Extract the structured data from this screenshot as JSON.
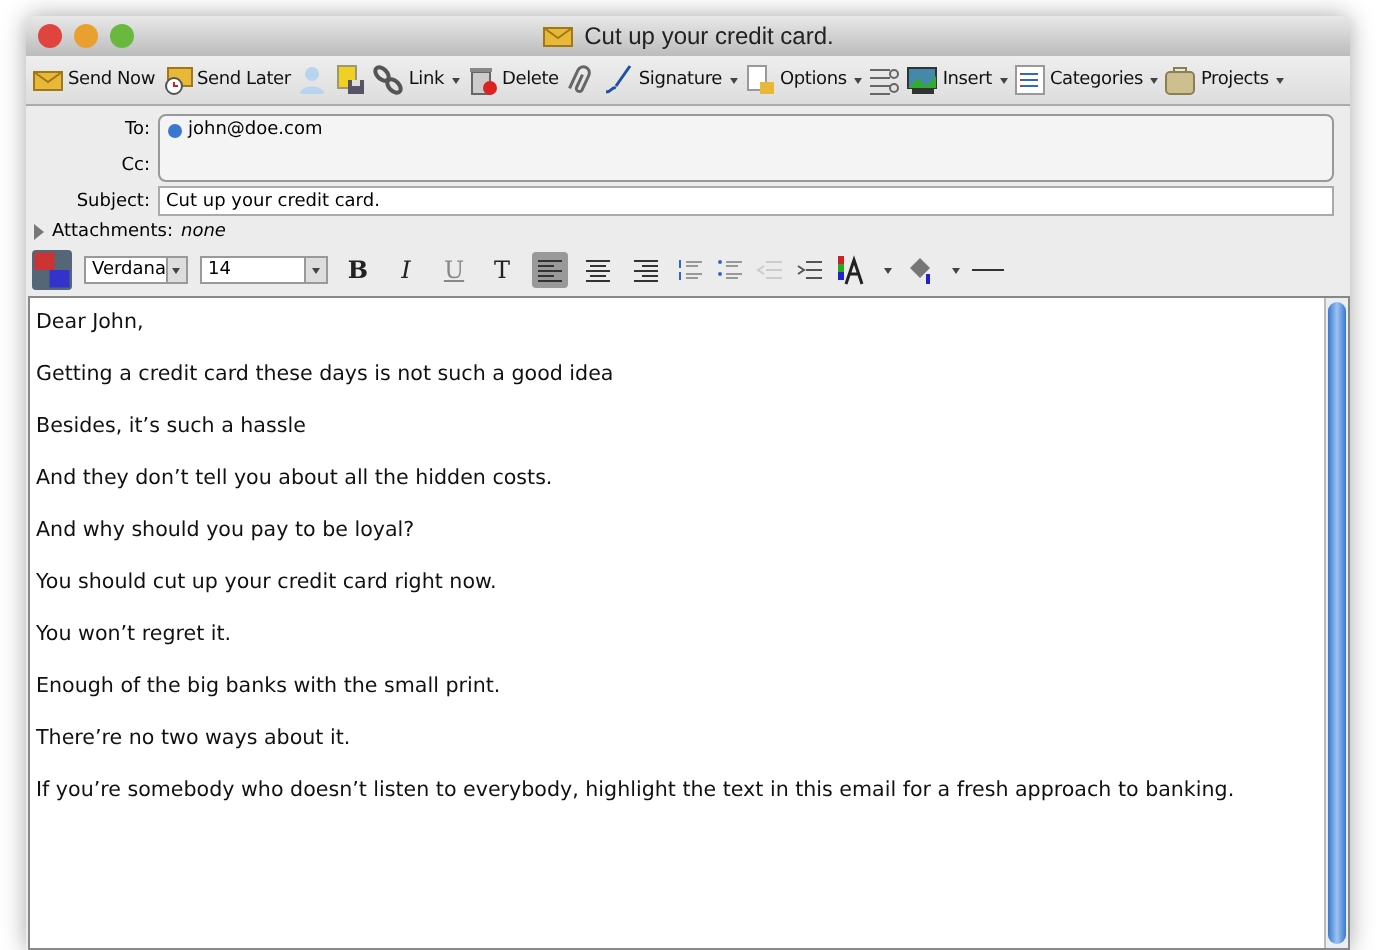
{
  "window": {
    "title": "Cut up your credit card."
  },
  "toolbar": [
    {
      "kind": "button",
      "label": "Send Now"
    },
    {
      "kind": "button",
      "label": "Send Later"
    },
    {
      "kind": "icon"
    },
    {
      "kind": "icon"
    },
    {
      "kind": "menu",
      "label": "Link"
    },
    {
      "kind": "button",
      "label": "Delete"
    },
    {
      "kind": "icon"
    },
    {
      "kind": "menu",
      "label": "Signature"
    },
    {
      "kind": "menu",
      "label": "Options"
    },
    {
      "kind": "icon"
    },
    {
      "kind": "menu",
      "label": "Insert"
    },
    {
      "kind": "menu",
      "label": "Categories"
    },
    {
      "kind": "menu",
      "label": "Projects"
    }
  ],
  "header": {
    "to_label": "To:",
    "to": "john@doe.com",
    "cc_label": "Cc:",
    "subject_label": "Subject:",
    "subject": "Cut up your credit card.",
    "attachments_label": "Attachments:",
    "attachments": "none"
  },
  "format": {
    "font": "Verdana",
    "size": "14",
    "styles": [
      {
        "label": "B",
        "kind": "bold"
      },
      {
        "label": "I",
        "kind": "italic"
      },
      {
        "label": "U",
        "kind": "underline"
      },
      {
        "label": "T",
        "kind": "plain"
      }
    ],
    "align": [
      {
        "kind": "left",
        "selected": true
      },
      {
        "kind": "center",
        "selected": false
      },
      {
        "kind": "right",
        "selected": false
      }
    ]
  },
  "body": [
    "Dear John,",
    "Getting a credit card these days is not such a good idea",
    "Besides, it’s such a hassle",
    "And they don’t tell you about all the hidden costs.",
    "And why should you pay to be loyal?",
    "You should cut up your credit card right now.",
    "You won’t regret it.",
    "Enough of the big banks with the small print.",
    "There’re no two ways about it.",
    "If you’re somebody who doesn’t listen to everybody, highlight the text in this email for a fresh approach to banking."
  ]
}
